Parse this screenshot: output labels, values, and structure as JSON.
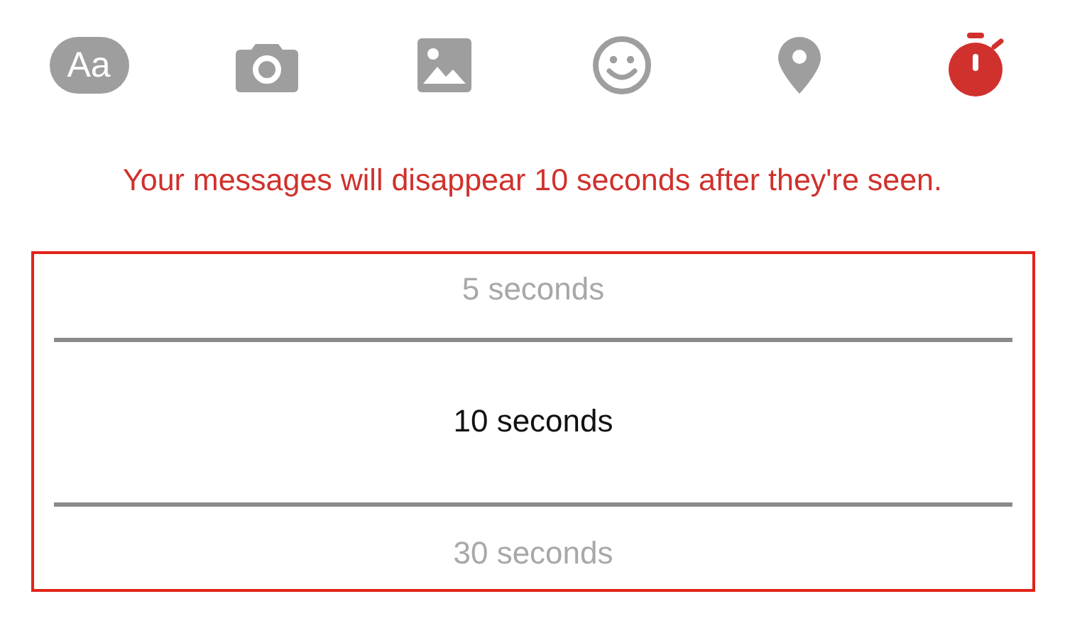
{
  "toolbar": [
    {
      "kind": "text",
      "label": "Aa",
      "selected": false
    },
    {
      "kind": "camera",
      "selected": false
    },
    {
      "kind": "image",
      "selected": false
    },
    {
      "kind": "emoji",
      "selected": false
    },
    {
      "kind": "location",
      "selected": false
    },
    {
      "kind": "timer",
      "selected": true
    }
  ],
  "message": "Your messages will disappear 10 seconds after they're seen.",
  "options": [
    {
      "label": "5 seconds",
      "selected": false
    },
    {
      "label": "10 seconds",
      "selected": true
    },
    {
      "label": "30 seconds",
      "selected": false
    }
  ]
}
